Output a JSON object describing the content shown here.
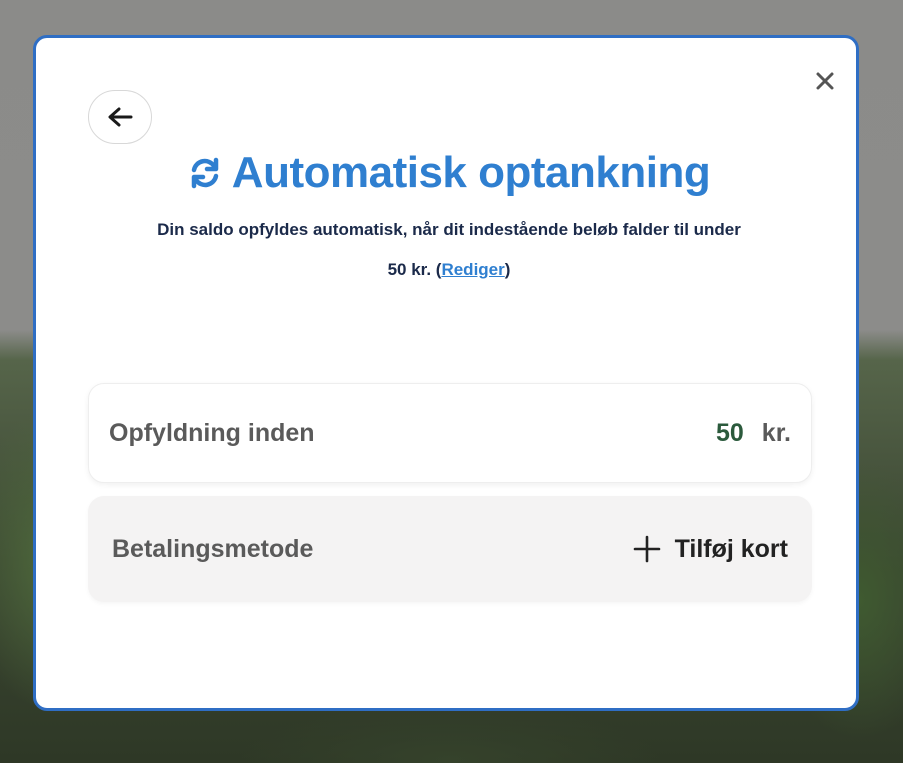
{
  "modal": {
    "title": "Automatisk optankning",
    "description_line1": "Din saldo opfyldes automatisk, når dit indestående beløb falder til under",
    "description_amount": "50 kr. (",
    "edit_link": "Rediger",
    "description_close": ")",
    "icons": {
      "close": "close-icon",
      "back": "arrow-left-icon",
      "title": "refresh-icon",
      "add": "plus-icon"
    },
    "accent_color": "#2f7fd0",
    "border_color": "#2f6ec4"
  },
  "threshold": {
    "label": "Opfyldning inden",
    "value": "50",
    "unit": "kr."
  },
  "payment": {
    "label": "Betalingsmetode",
    "add_label": "Tilføj kort"
  }
}
